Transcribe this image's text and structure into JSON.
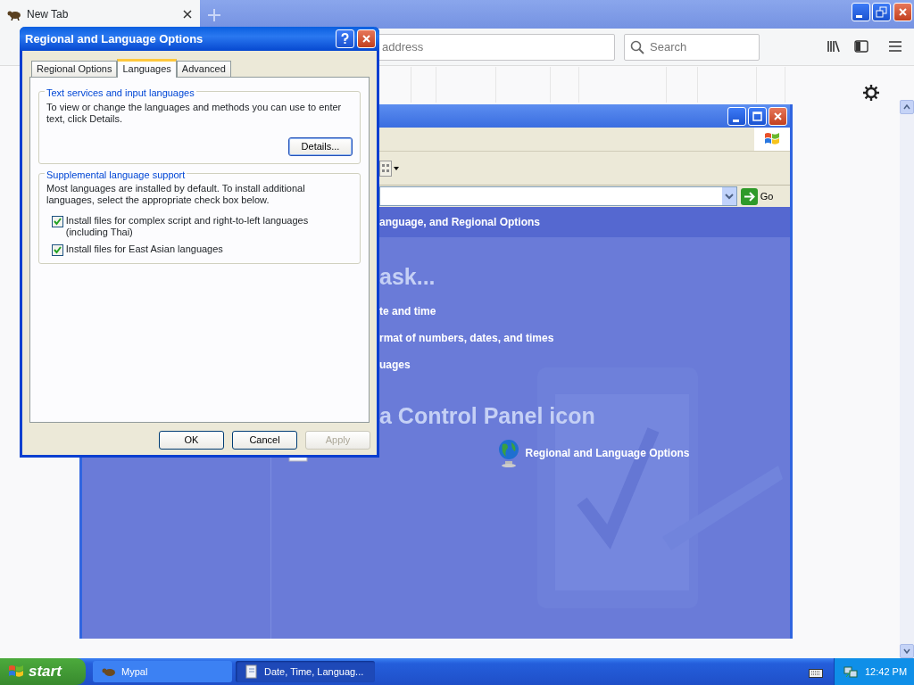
{
  "browser": {
    "tab": {
      "title": "New Tab"
    },
    "address": {
      "placeholder": "address"
    },
    "search": {
      "placeholder": "Search"
    }
  },
  "control_panel": {
    "go": "Go",
    "header": "anguage, and Regional Options",
    "task_heading": "ask...",
    "tasks": [
      "te and time",
      "rmat of numbers, dates, and times",
      "uages"
    ],
    "icon_heading": "a Control Panel icon",
    "icons": [
      {
        "label": "Regional and Language Options"
      }
    ]
  },
  "dialog": {
    "title": "Regional and Language Options",
    "tabs": [
      {
        "label": "Regional Options",
        "selected": false
      },
      {
        "label": "Languages",
        "selected": true
      },
      {
        "label": "Advanced",
        "selected": false
      }
    ],
    "groups": [
      {
        "title": "Text services and input languages",
        "text": "To view or change the languages and methods you can use to enter text, click Details.",
        "button": "Details..."
      },
      {
        "title": "Supplemental language support",
        "text": "Most languages are installed by default. To install additional languages, select the appropriate check box below.",
        "options": [
          {
            "label": "Install files for complex script and right-to-left languages (including Thai)",
            "checked": true
          },
          {
            "label": "Install files for East Asian languages",
            "checked": true
          }
        ]
      }
    ],
    "buttons": [
      {
        "label": "OK",
        "disabled": false
      },
      {
        "label": "Cancel",
        "disabled": false
      },
      {
        "label": "Apply",
        "disabled": true
      }
    ]
  },
  "taskbar": {
    "start": "start",
    "tasks": [
      {
        "label": "Mypal",
        "selected": false
      },
      {
        "label": "Date, Time, Languag...",
        "selected": true
      }
    ],
    "clock": "12:42 PM"
  }
}
